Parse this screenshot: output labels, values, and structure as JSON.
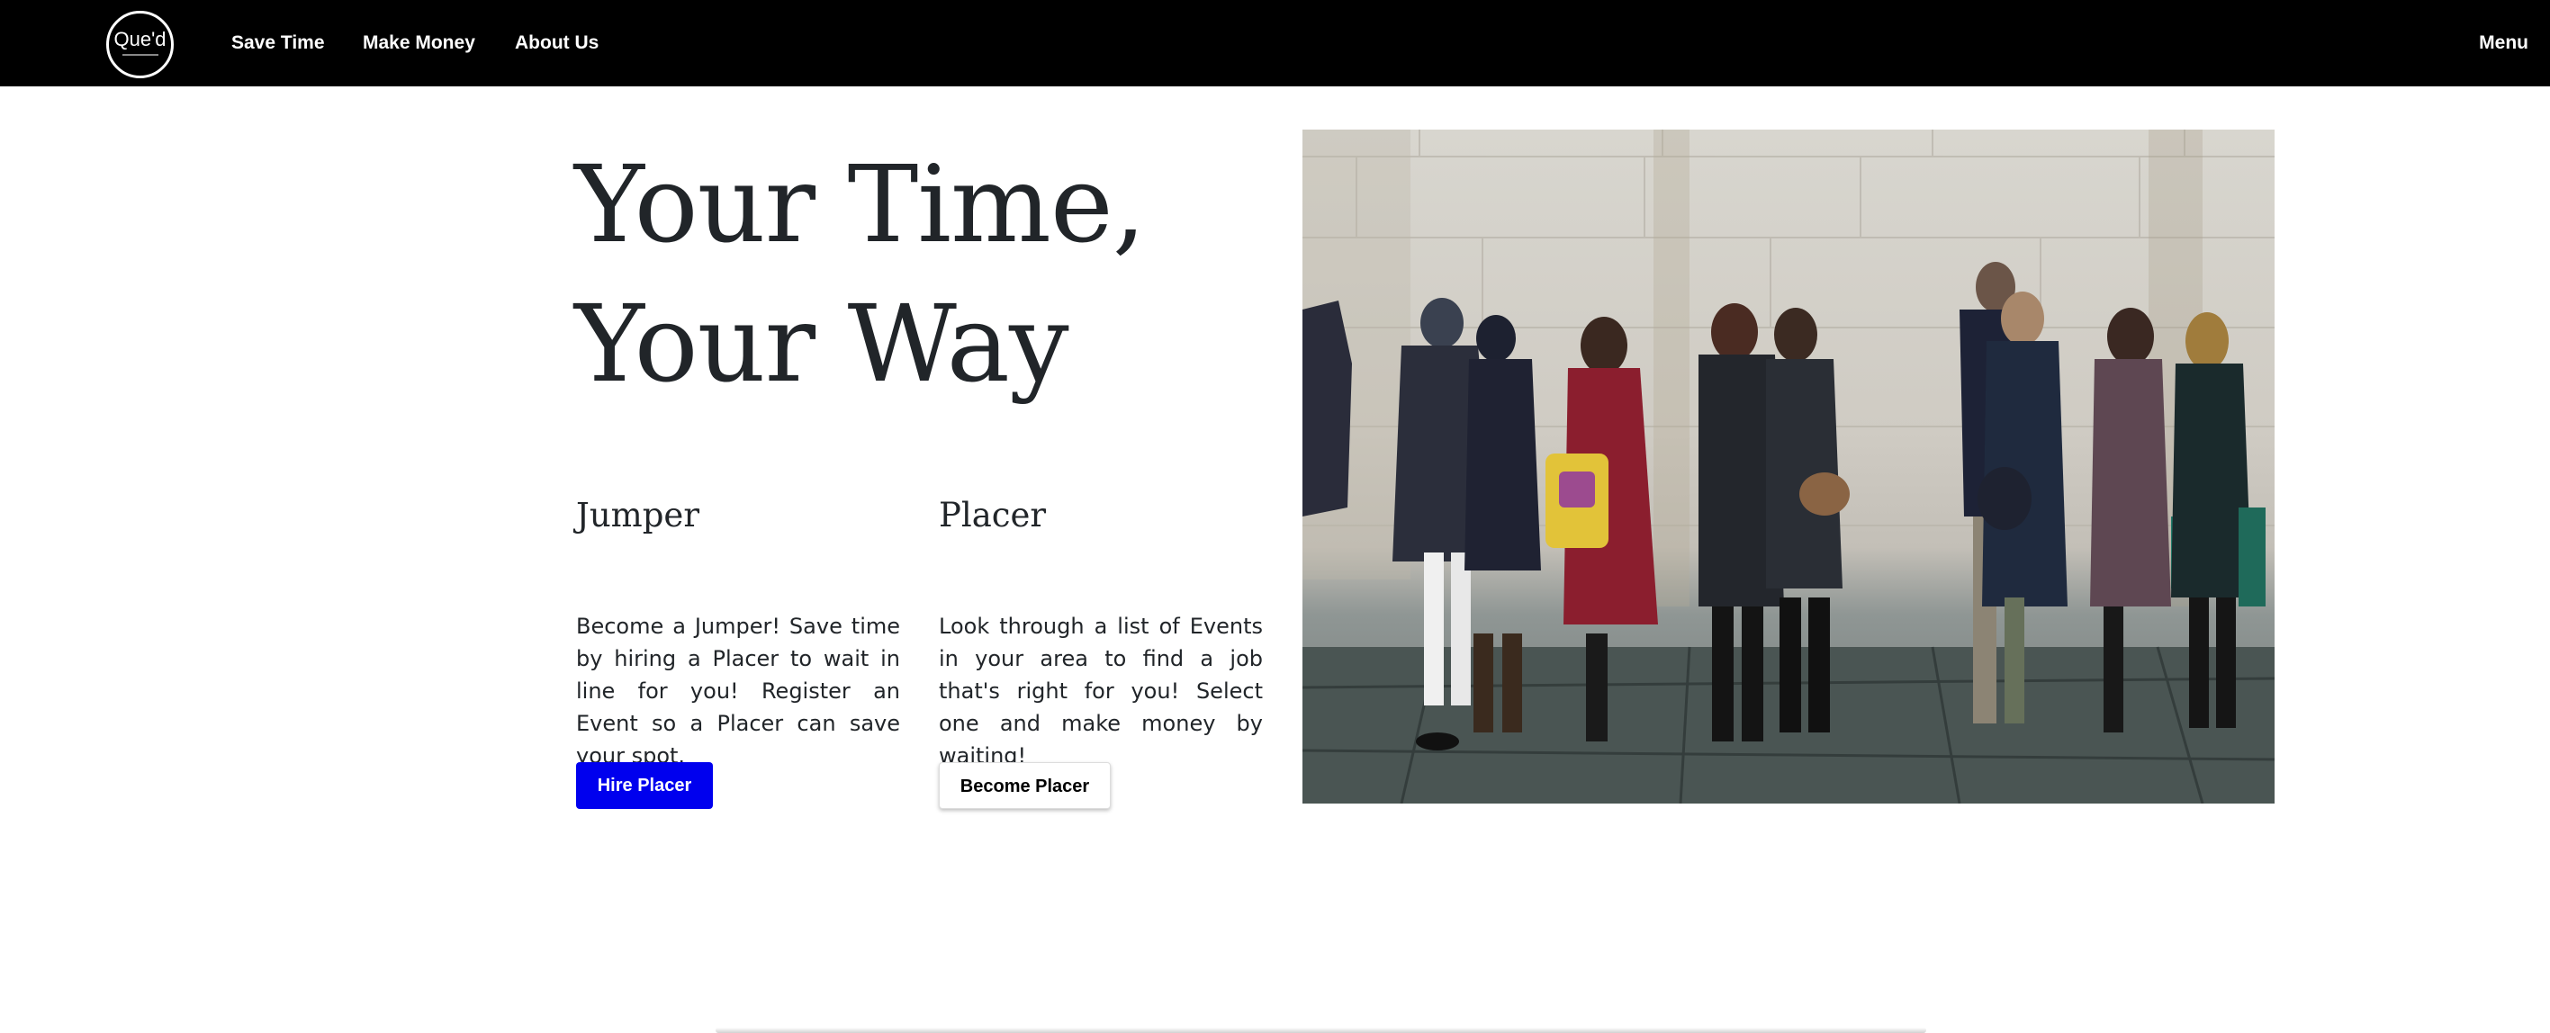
{
  "nav": {
    "logo_text": "Que'd",
    "links": [
      "Save Time",
      "Make Money",
      "About Us"
    ],
    "menu_label": "Menu"
  },
  "hero": {
    "title_line1": "Your Time,",
    "title_line2": "Your Way"
  },
  "jumper": {
    "title": "Jumper",
    "text": "Become a Jumper! Save time by hiring a Placer to wait in line for you! Register an Event so a Placer can save your spot.",
    "button": "Hire Placer"
  },
  "placer": {
    "title": "Placer",
    "text": "Look through a list of Events in your area to find a job that's right for you! Select one and make money by waiting!",
    "button": "Become Placer"
  },
  "colors": {
    "navbar_bg": "#000000",
    "primary_button": "#0000ee",
    "text": "#212529"
  }
}
